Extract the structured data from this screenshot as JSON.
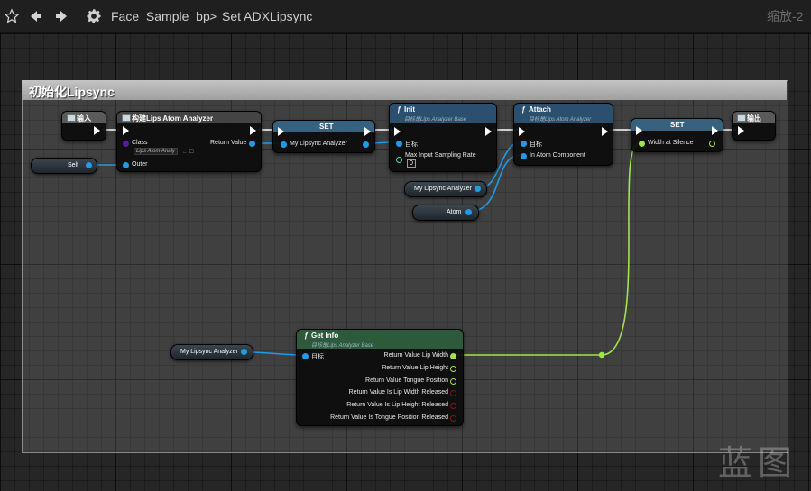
{
  "toolbar": {
    "breadcrumb_blueprint": "Face_Sample_bp",
    "breadcrumb_separator": ">",
    "breadcrumb_graph": "Set ADXLipsync",
    "zoom": "缩放-2"
  },
  "comment": {
    "title": "初始化Lipsync"
  },
  "nodes": {
    "input": {
      "title": "输入"
    },
    "construct": {
      "title": "构建Lips Atom Analyzer",
      "class_label": "Class",
      "class_value": "Lips Atom Analy",
      "return_label": "Return Value",
      "outer_label": "Outer"
    },
    "self_var": {
      "label": "Self"
    },
    "set_analyzer": {
      "title": "SET",
      "pin_label": "My Lipsync Analyzer"
    },
    "init": {
      "title": "Init",
      "subtitle": "目标是Lips Analyzer Base",
      "target_label": "目标",
      "max_sampling_label": "Max Input Sampling Rate",
      "max_sampling_value": "0"
    },
    "analyzer_var": {
      "label": "My Lipsync Analyzer"
    },
    "atom_var": {
      "label": "Atom"
    },
    "attach": {
      "title": "Attach",
      "subtitle": "目标是Lips Atom Analyzer",
      "target_label": "目标",
      "component_label": "In Atom Component"
    },
    "set_width": {
      "title": "SET",
      "pin_label": "Width at Silence"
    },
    "output": {
      "title": "输出"
    },
    "analyzer_var2": {
      "label": "My Lipsync Analyzer"
    },
    "get_info": {
      "title": "Get Info",
      "subtitle": "目标是Lips Analyzer Base",
      "target_label": "目标",
      "outputs": [
        "Return Value Lip Width",
        "Return Value Lip Height",
        "Return Value Tongue Position",
        "Return Value Is Lip Width Released",
        "Return Value Is Lip Height Released",
        "Return Value Is Tongue Position Released"
      ]
    }
  },
  "watermark": "蓝图",
  "colors": {
    "object_pin": "#1f9be8",
    "float_pin": "#9fe34d",
    "bool_pin": "#8c1010",
    "class_pin": "#5a1aa0",
    "func_header": "#2b4f6f",
    "set_header": "#36617f"
  }
}
